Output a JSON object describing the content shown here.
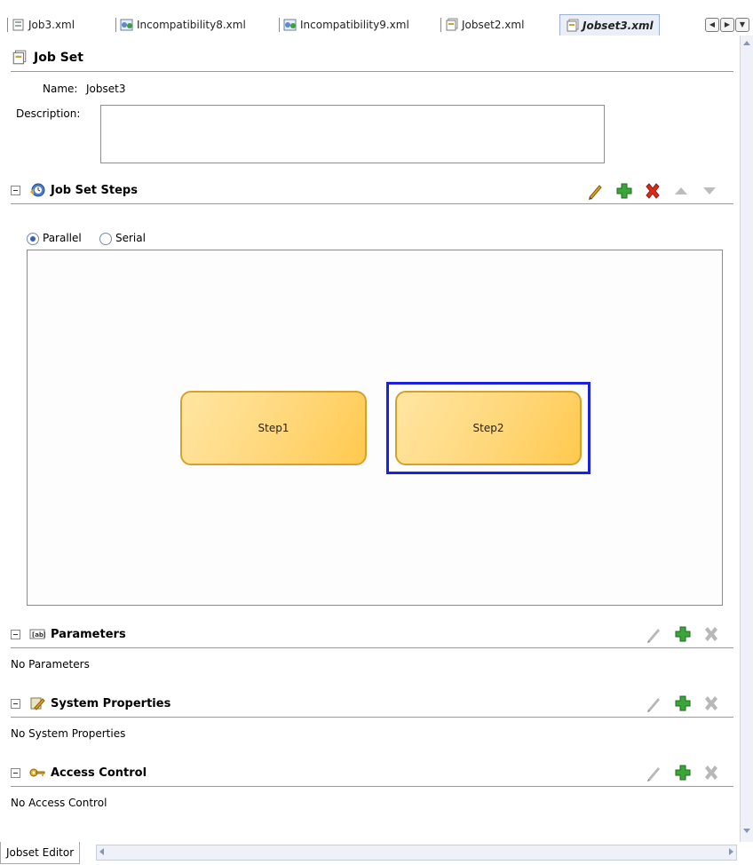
{
  "tabs": [
    {
      "label": "Job3.xml"
    },
    {
      "label": "Incompatibility8.xml"
    },
    {
      "label": "Incompatibility9.xml"
    },
    {
      "label": "Jobset2.xml"
    },
    {
      "label": "Jobset3.xml",
      "active": true
    }
  ],
  "header": {
    "title": "Job Set"
  },
  "form": {
    "name_label": "Name:",
    "name_value": "Jobset3",
    "description_label": "Description:",
    "description_value": ""
  },
  "steps_section": {
    "title": "Job Set Steps",
    "radio_parallel": "Parallel",
    "radio_serial": "Serial",
    "selected_mode": "Parallel",
    "steps": [
      {
        "label": "Step1",
        "selected": false
      },
      {
        "label": "Step2",
        "selected": true
      }
    ]
  },
  "parameters_section": {
    "title": "Parameters",
    "empty_text": "No Parameters"
  },
  "system_properties_section": {
    "title": "System Properties",
    "empty_text": "No System Properties"
  },
  "access_control_section": {
    "title": "Access Control",
    "empty_text": "No Access Control"
  },
  "bottom": {
    "editor_tab": "Jobset Editor"
  },
  "colors": {
    "selection": "#1a22e0",
    "step_fill": "#ffd77a",
    "add": "#2e9a2e",
    "delete": "#d92a1a"
  }
}
